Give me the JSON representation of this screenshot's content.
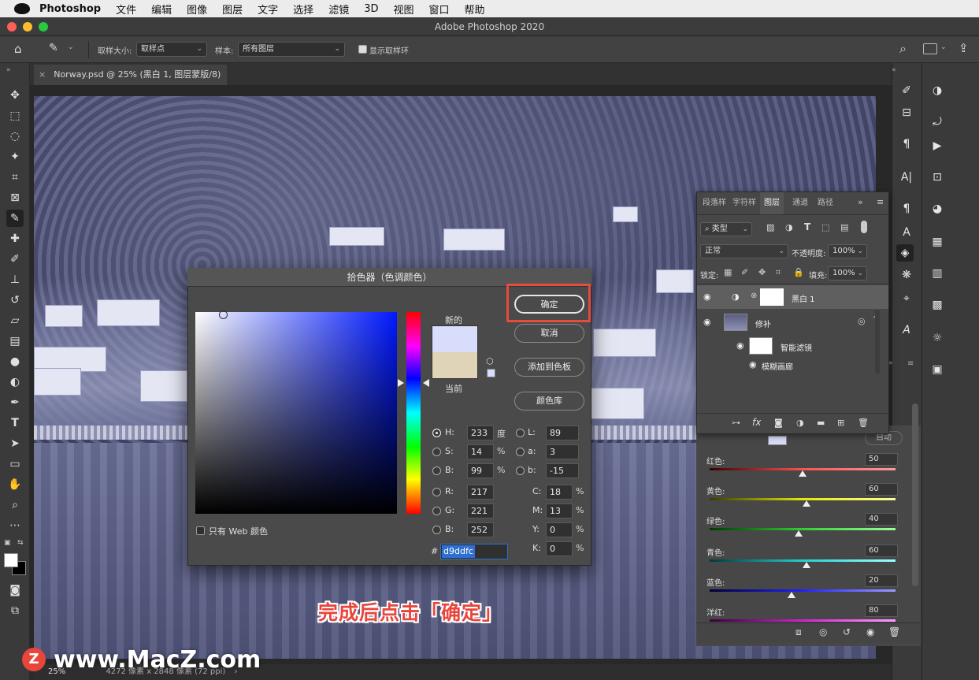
{
  "menubar": {
    "app_name": "Photoshop",
    "items": [
      "文件",
      "编辑",
      "图像",
      "图层",
      "文字",
      "选择",
      "滤镜",
      "3D",
      "视图",
      "窗口",
      "帮助"
    ]
  },
  "window": {
    "title": "Adobe Photoshop 2020"
  },
  "options": {
    "sample_size_label": "取样大小:",
    "sample_size_value": "取样点",
    "sample_label": "样本:",
    "sample_value": "所有图层",
    "show_ring_label": "显示取样环"
  },
  "document": {
    "tab_title": "Norway.psd @ 25% (黑白 1, 图层蒙版/8) *",
    "zoom": "25%",
    "dimensions": "4272 像素 x 2848 像素 (72 ppi)"
  },
  "layers_panel": {
    "tabs": [
      "段落样",
      "字符样",
      "图层",
      "通道",
      "路径"
    ],
    "filter_kind": "类型",
    "blend_mode": "正常",
    "opacity_label": "不透明度:",
    "opacity_value": "100%",
    "lock_label": "锁定:",
    "fill_label": "填充:",
    "fill_value": "100%",
    "layers": [
      {
        "name": "黑白 1"
      },
      {
        "name": "修补"
      },
      {
        "name": "智能滤镜"
      },
      {
        "name": "模糊画廊"
      }
    ]
  },
  "properties_panel": {
    "sliders": [
      {
        "label": "红色:",
        "value": "50",
        "pos": 0.5
      },
      {
        "label": "黄色:",
        "value": "60",
        "pos": 0.52
      },
      {
        "label": "绿色:",
        "value": "40",
        "pos": 0.48
      },
      {
        "label": "青色:",
        "value": "60",
        "pos": 0.52
      },
      {
        "label": "蓝色:",
        "value": "20",
        "pos": 0.44
      },
      {
        "label": "洋红:",
        "value": "80",
        "pos": 0.58
      }
    ],
    "auto_label": "自动"
  },
  "color_picker": {
    "title": "拾色器（色调颜色）",
    "new_label": "新的",
    "current_label": "当前",
    "buttons": {
      "ok": "确定",
      "cancel": "取消",
      "add_swatch": "添加到色板",
      "libraries": "颜色库"
    },
    "hsb": {
      "h_label": "H:",
      "h": "233",
      "h_unit": "度",
      "s_label": "S:",
      "s": "14",
      "s_unit": "%",
      "b_label": "B:",
      "b": "99",
      "b_unit": "%"
    },
    "lab": {
      "l_label": "L:",
      "l": "89",
      "a_label": "a:",
      "a": "3",
      "b_label": "b:",
      "b": "-15"
    },
    "rgb": {
      "r_label": "R:",
      "r": "217",
      "g_label": "G:",
      "g": "221",
      "b_label": "B:",
      "b": "252"
    },
    "cmyk": {
      "c_label": "C:",
      "c": "18",
      "m_label": "M:",
      "m": "13",
      "y_label": "Y:",
      "y": "0",
      "k_label": "K:",
      "k": "0",
      "unit": "%"
    },
    "hex_label": "#",
    "hex": "d9ddfc",
    "web_only_label": "只有 Web 颜色",
    "new_color": "#d9ddfc",
    "current_color": "#dfd3b8"
  },
  "annotation": {
    "text": "完成后点击「确定」"
  },
  "watermark": {
    "logo": "Z",
    "text": "www.MacZ.com"
  }
}
